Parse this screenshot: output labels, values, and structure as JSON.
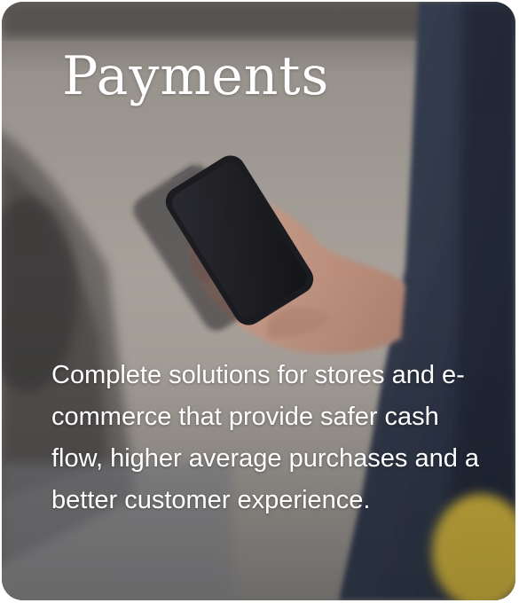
{
  "card": {
    "title": "Payments",
    "description": "Complete solutions for stores and e-commerce that provide safer cash flow, higher average purchases and a better customer experience."
  },
  "colors": {
    "text": "#ffffff",
    "jacket": "#2f3a4f",
    "phone": "#1c1d22",
    "skin": "#c79a86",
    "accent_yellow": "#e2c13a"
  }
}
